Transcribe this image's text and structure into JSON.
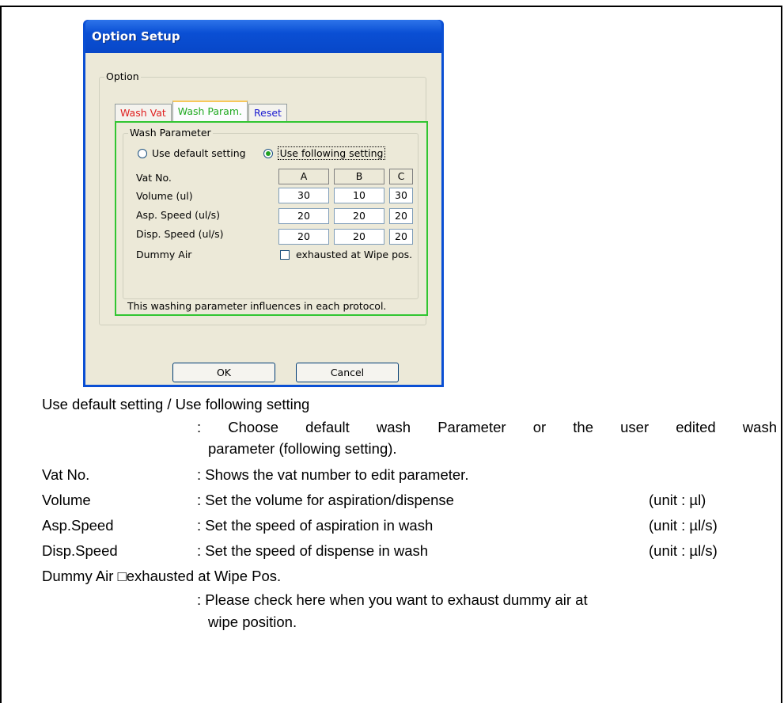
{
  "dialog": {
    "title": "Option Setup",
    "option_group_label": "Option",
    "tabs": [
      {
        "label": "Wash Vat",
        "color": "#e02020"
      },
      {
        "label": "Wash Param.",
        "color": "#22aa22",
        "active": true
      },
      {
        "label": "Reset",
        "color": "#1a1ad0"
      }
    ],
    "wash_group_label": "Wash Parameter",
    "radio_default": "Use default setting",
    "radio_following": "Use following setting",
    "selected_radio": "Use following setting",
    "labels": {
      "vat_no": "Vat No.",
      "volume": "Volume (ul)",
      "asp_speed": "Asp. Speed (ul/s)",
      "disp_speed": "Disp. Speed (ul/s)",
      "dummy_air": "Dummy Air"
    },
    "columns": [
      "A",
      "B",
      "C"
    ],
    "volume_values": [
      "30",
      "10",
      "30"
    ],
    "asp_speed_values": [
      "20",
      "20",
      "20"
    ],
    "disp_speed_values": [
      "20",
      "20",
      "20"
    ],
    "checkbox_label": "exhausted at Wipe pos.",
    "checkbox_checked": false,
    "footer_note": "This washing parameter influences in each protocol.",
    "ok_label": "OK",
    "cancel_label": "Cancel"
  },
  "description": {
    "line_use_setting": "Use default setting / Use following setting",
    "line_use_setting_desc_1": ": Choose default wash Parameter or the user edited wash",
    "line_use_setting_desc_2": "parameter (following setting).",
    "vat_term": "Vat No.",
    "vat_desc": ": Shows the vat number to edit parameter.",
    "volume_term": "Volume",
    "volume_desc": ": Set the volume for aspiration/dispense",
    "volume_unit": "(unit : µl)",
    "asp_term": "Asp.Speed",
    "asp_desc": ": Set the speed of aspiration in wash",
    "asp_unit": "(unit : µl/s)",
    "disp_term": "Disp.Speed",
    "disp_desc": ": Set the speed of dispense in wash",
    "disp_unit": "(unit : µl/s)",
    "dummy_line": "Dummy Air □exhausted at Wipe Pos.",
    "dummy_desc_1": ": Please check here when you want to exhaust dummy air at",
    "dummy_desc_2": "wipe position."
  }
}
